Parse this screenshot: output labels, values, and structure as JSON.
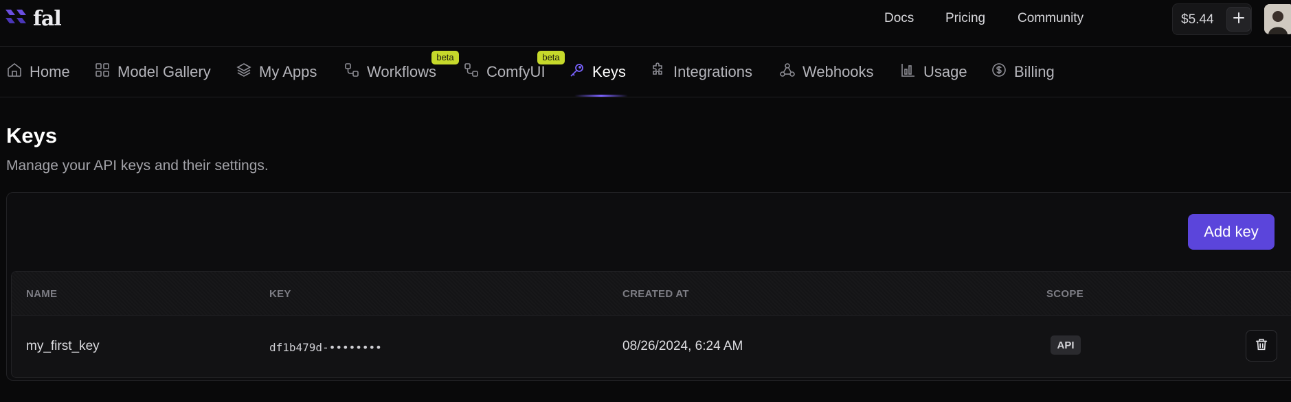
{
  "brand": {
    "name": "fal"
  },
  "topnav": {
    "docs": "Docs",
    "pricing": "Pricing",
    "community": "Community"
  },
  "account": {
    "balance": "$5.44",
    "add_funds_label": "+"
  },
  "tabs": [
    {
      "label": "Home",
      "icon": "home-icon"
    },
    {
      "label": "Model Gallery",
      "icon": "grid-icon"
    },
    {
      "label": "My Apps",
      "icon": "layers-icon"
    },
    {
      "label": "Workflows",
      "icon": "workflow-icon",
      "badge": "beta"
    },
    {
      "label": "ComfyUI",
      "icon": "workflow-icon",
      "badge": "beta"
    },
    {
      "label": "Keys",
      "icon": "key-icon",
      "active": true
    },
    {
      "label": "Integrations",
      "icon": "puzzle-icon"
    },
    {
      "label": "Webhooks",
      "icon": "webhook-icon"
    },
    {
      "label": "Usage",
      "icon": "bar-chart-icon"
    },
    {
      "label": "Billing",
      "icon": "dollar-circle-icon"
    }
  ],
  "page": {
    "title": "Keys",
    "subtitle": "Manage your API keys and their settings.",
    "add_key_label": "Add key"
  },
  "table": {
    "columns": [
      "NAME",
      "KEY",
      "CREATED AT",
      "SCOPE"
    ],
    "rows": [
      {
        "name": "my_first_key",
        "key": "df1b479d-••••••••",
        "created_at": "08/26/2024, 6:24 AM",
        "scope": "API"
      }
    ]
  },
  "colors": {
    "accent": "#5b45db",
    "beta_badge": "#c6d92b",
    "background": "#09090a"
  }
}
